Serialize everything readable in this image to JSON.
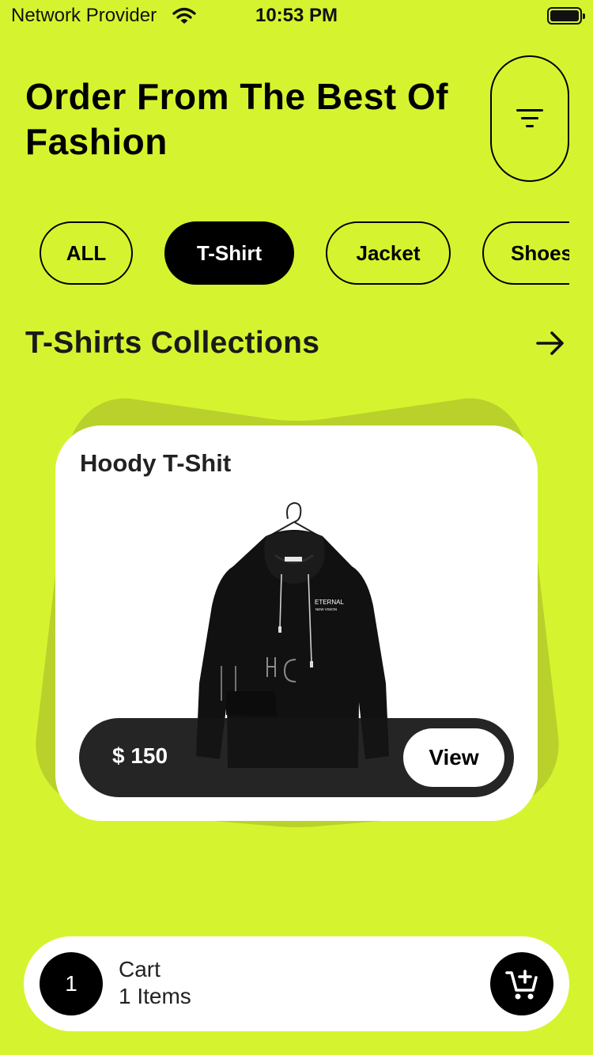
{
  "status_bar": {
    "carrier": "Network Provider",
    "time": "10:53 PM",
    "icons": [
      "wifi-icon",
      "battery-icon"
    ]
  },
  "header": {
    "title": "Order From The Best Of Fashion",
    "filter_icon": "filter-icon"
  },
  "categories": [
    {
      "label": "ALL",
      "active": false
    },
    {
      "label": "T-Shirt",
      "active": true
    },
    {
      "label": "Jacket",
      "active": false
    },
    {
      "label": "Shoes",
      "active": false
    }
  ],
  "section": {
    "title": "T-Shirts Collections",
    "arrow_icon": "arrow-right-icon"
  },
  "product": {
    "name": "Hoody T-Shit",
    "price": "$ 150",
    "view_label": "View",
    "chest_print": "ETERNAL",
    "chest_print_sub": "NEW VISION"
  },
  "cart": {
    "count": "1",
    "label": "Cart",
    "items_text": "1 Items",
    "icon": "add-to-cart-icon"
  },
  "colors": {
    "background": "#d5f42f",
    "card_shadow": "#bad12b",
    "dark": "#000000",
    "card": "#ffffff"
  }
}
